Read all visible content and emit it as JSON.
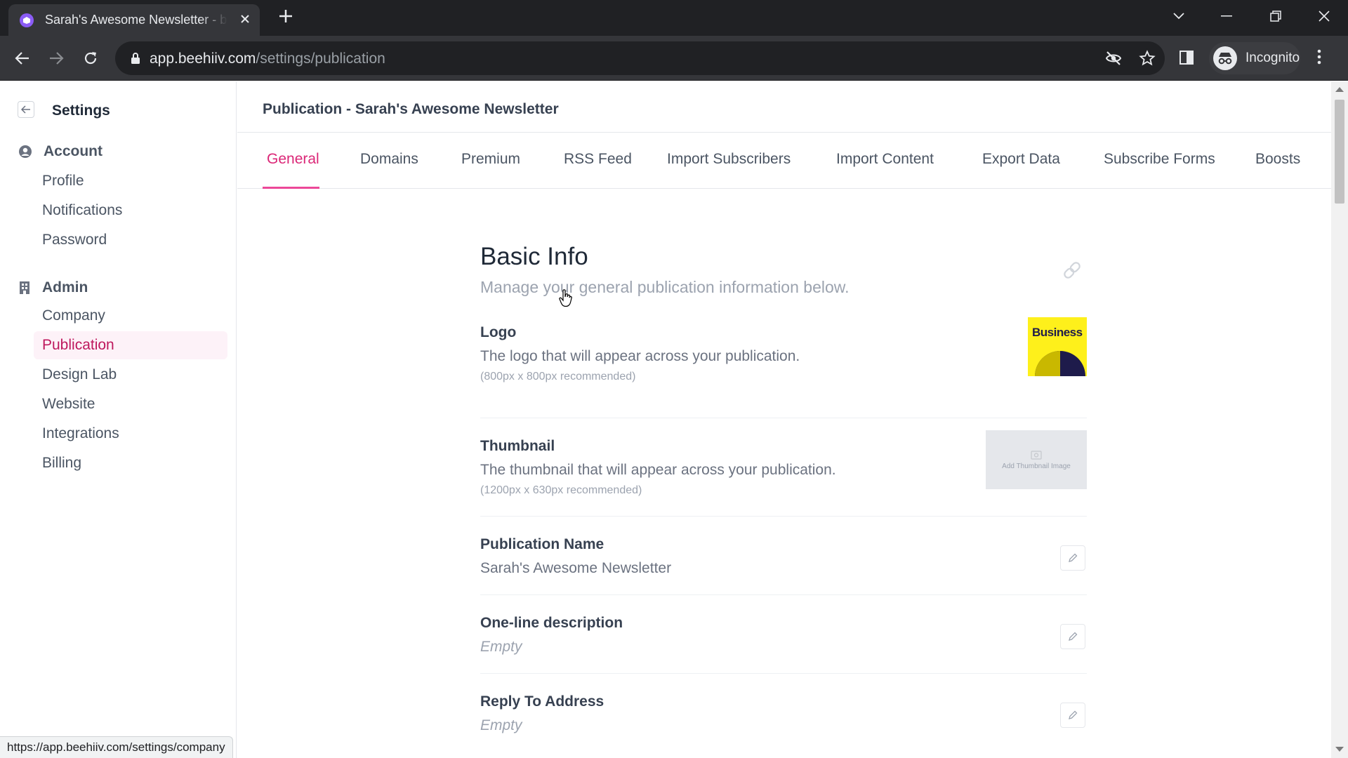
{
  "browser": {
    "tab_title": "Sarah's Awesome Newsletter - beehiiv",
    "url_host": "app.beehiiv.com",
    "url_path": "/settings/publication",
    "profile_label": "Incognito",
    "status_url": "https://app.beehiiv.com/settings/company"
  },
  "sidebar": {
    "title": "Settings",
    "account": {
      "label": "Account",
      "items": [
        "Profile",
        "Notifications",
        "Password"
      ]
    },
    "admin": {
      "label": "Admin",
      "items": [
        "Company",
        "Publication",
        "Design Lab",
        "Website",
        "Integrations",
        "Billing"
      ]
    },
    "active_item": "Publication"
  },
  "main": {
    "page_title": "Publication - Sarah's Awesome Newsletter",
    "tabs": [
      "General",
      "Domains",
      "Premium",
      "RSS Feed",
      "Import Subscribers",
      "Import Content",
      "Export Data",
      "Subscribe Forms",
      "Boosts"
    ],
    "active_tab": "General",
    "section": {
      "title": "Basic Info",
      "subtitle": "Manage your general publication information below."
    },
    "logo": {
      "label": "Logo",
      "description": "The logo that will appear across your publication.",
      "hint": "(800px x 800px recommended)",
      "image_text": "Business"
    },
    "thumbnail": {
      "label": "Thumbnail",
      "description": "The thumbnail that will appear across your publication.",
      "hint": "(1200px x 630px recommended)",
      "placeholder": "Add Thumbnail Image"
    },
    "fields": [
      {
        "label": "Publication Name",
        "value": "Sarah's Awesome Newsletter"
      },
      {
        "label": "One-line description",
        "value": "Empty"
      },
      {
        "label": "Reply To Address",
        "value": "Empty"
      }
    ]
  },
  "colors": {
    "accent": "#db2777",
    "active_bg": "#fdf2f8",
    "logo_yellow": "#fef01b",
    "logo_navy": "#1e1b4b"
  }
}
